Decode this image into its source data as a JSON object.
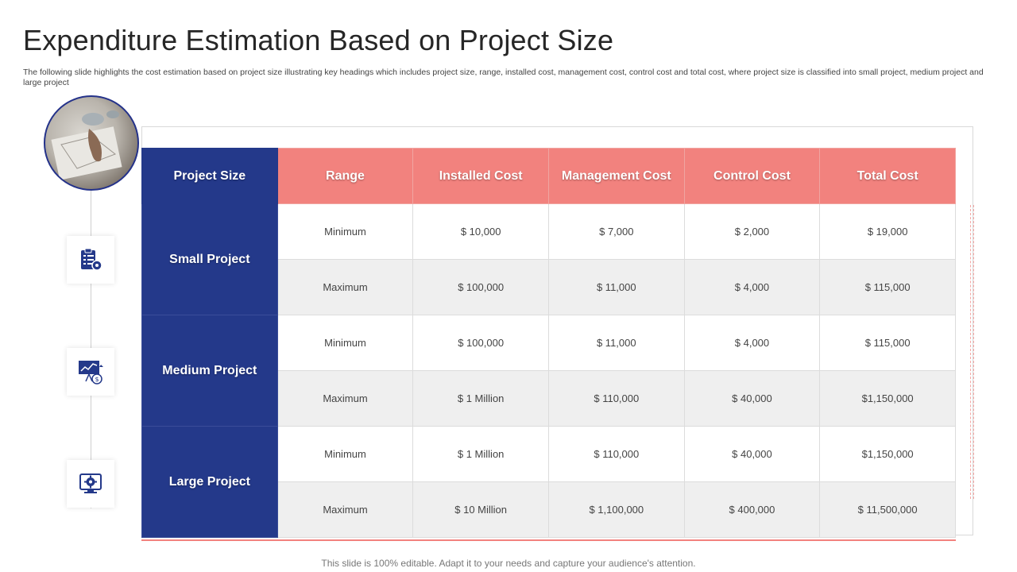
{
  "title": "Expenditure Estimation Based on Project Size",
  "subtitle": "The following slide highlights the cost estimation based on project size illustrating key headings which includes project size, range, installed cost, management cost, control cost and total cost, where project size is classified into small project, medium project and large project",
  "colors": {
    "navy": "#24398a",
    "salmon": "#f2827e",
    "alt_row": "#efefef"
  },
  "icons": [
    "clipboard-gear-icon",
    "presentation-dollar-icon",
    "monitor-gear-icon"
  ],
  "table": {
    "headers": [
      "Project Size",
      "Range",
      "Installed Cost",
      "Management Cost",
      "Control Cost",
      "Total Cost"
    ],
    "groups": [
      {
        "name": "Small Project",
        "rows": [
          [
            "Minimum",
            "$ 10,000",
            "$ 7,000",
            "$ 2,000",
            "$ 19,000"
          ],
          [
            "Maximum",
            "$ 100,000",
            "$ 11,000",
            "$ 4,000",
            "$ 115,000"
          ]
        ]
      },
      {
        "name": "Medium Project",
        "rows": [
          [
            "Minimum",
            "$ 100,000",
            "$ 11,000",
            "$ 4,000",
            "$ 115,000"
          ],
          [
            "Maximum",
            "$ 1 Million",
            "$ 110,000",
            "$ 40,000",
            "$1,150,000"
          ]
        ]
      },
      {
        "name": "Large Project",
        "rows": [
          [
            "Minimum",
            "$ 1 Million",
            "$ 110,000",
            "$ 40,000",
            "$1,150,000"
          ],
          [
            "Maximum",
            "$ 10 Million",
            "$ 1,100,000",
            "$ 400,000",
            "$ 11,500,000"
          ]
        ]
      }
    ]
  },
  "footer": "This slide is 100% editable. Adapt it to your needs and capture your audience's attention."
}
